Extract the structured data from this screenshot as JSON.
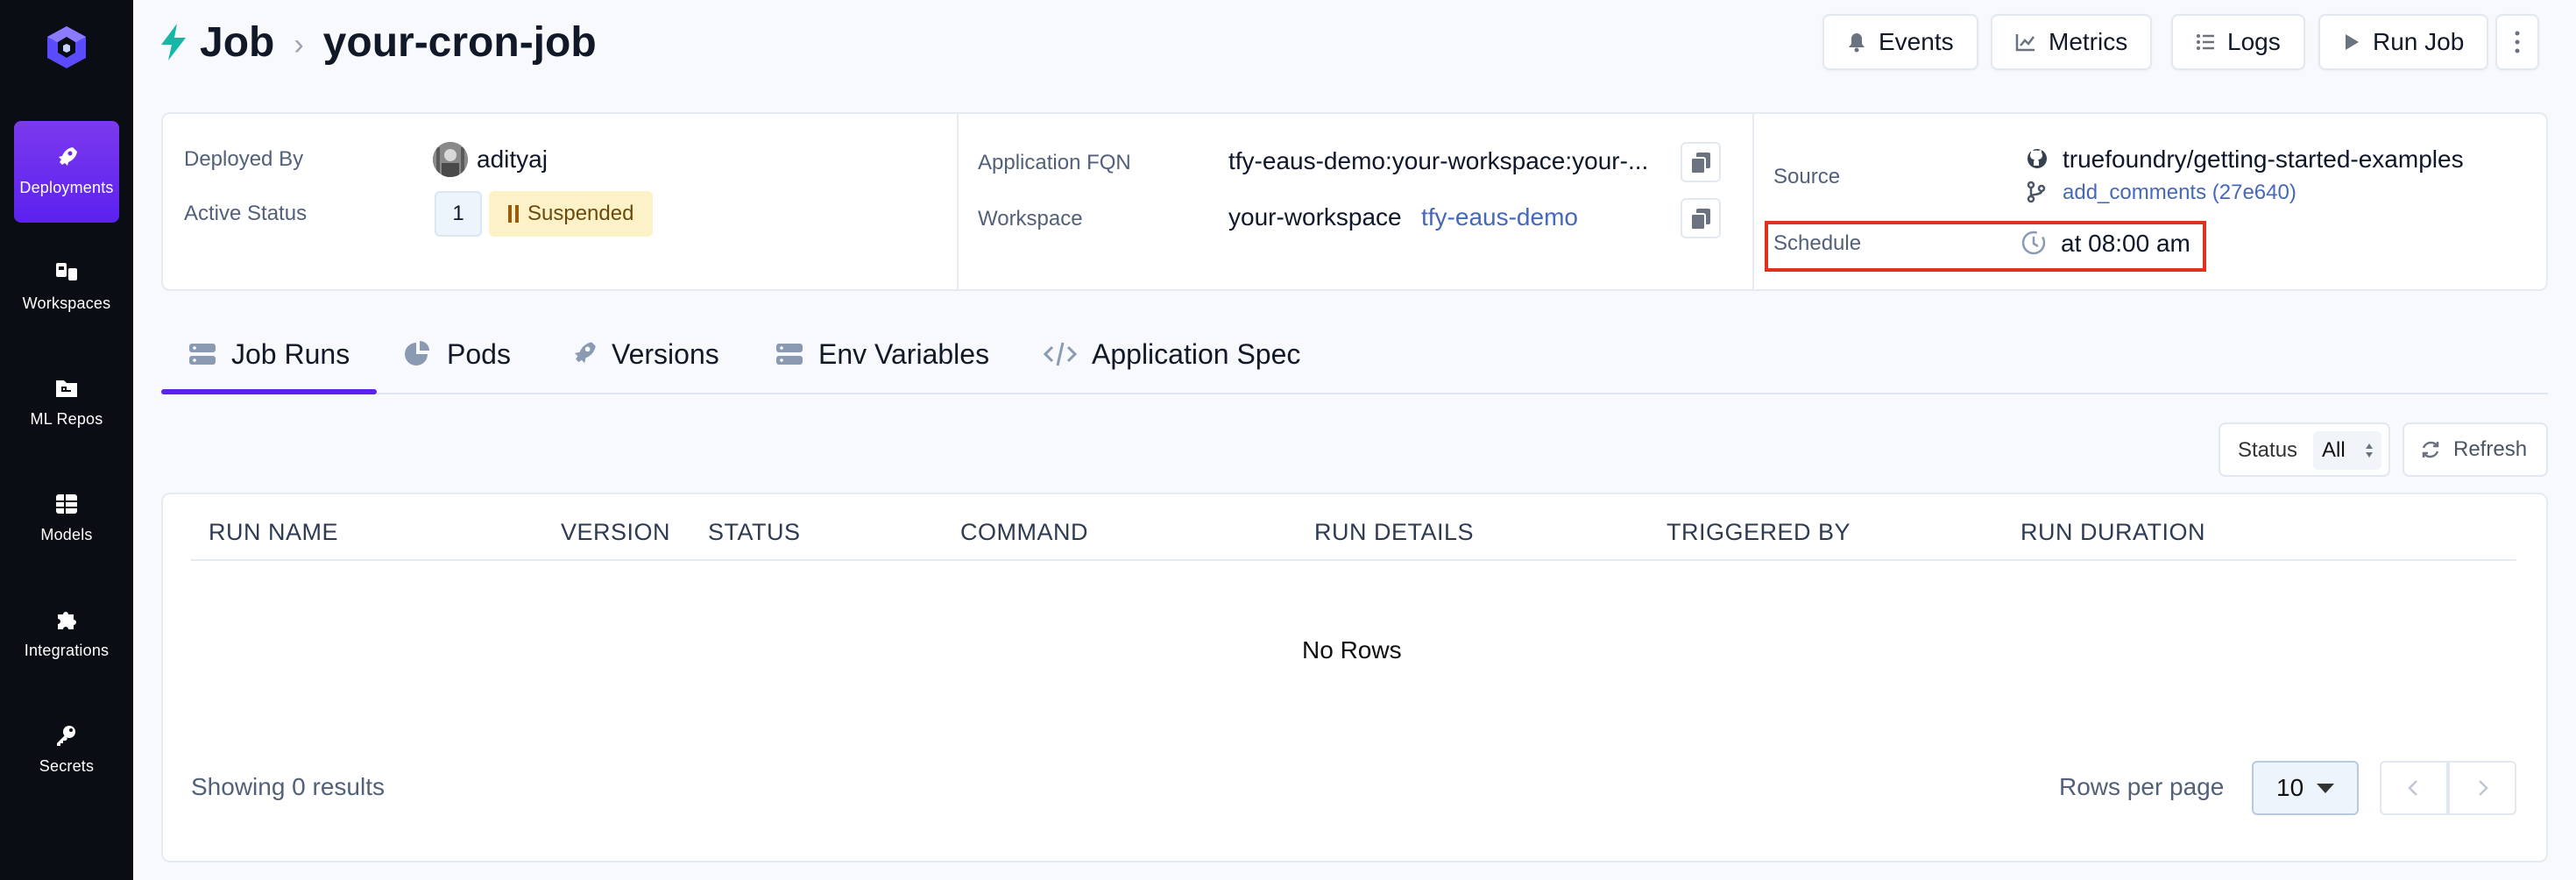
{
  "sidebar": {
    "items": [
      {
        "label": "Deployments",
        "icon": "rocket-icon",
        "active": true
      },
      {
        "label": "Workspaces",
        "icon": "workspaces-icon"
      },
      {
        "label": "ML Repos",
        "icon": "folder-icon"
      },
      {
        "label": "Models",
        "icon": "grid-icon"
      },
      {
        "label": "Integrations",
        "icon": "puzzle-icon"
      },
      {
        "label": "Secrets",
        "icon": "key-icon"
      }
    ]
  },
  "header": {
    "section": "Job",
    "job_name": "your-cron-job",
    "buttons": {
      "events": "Events",
      "metrics": "Metrics",
      "logs": "Logs",
      "run_job": "Run Job"
    }
  },
  "info": {
    "deployed_by_label": "Deployed By",
    "deployed_by": "adityaj",
    "active_status_label": "Active Status",
    "active_count": "1",
    "status": "Suspended",
    "fqn_label": "Application FQN",
    "fqn": "tfy-eaus-demo:your-workspace:your-...",
    "workspace_label": "Workspace",
    "workspace": "your-workspace",
    "cluster": "tfy-eaus-demo",
    "source_label": "Source",
    "repo": "truefoundry/getting-started-examples",
    "branch": "add_comments (27e640)",
    "schedule_label": "Schedule",
    "schedule": "at 08:00 am"
  },
  "tabs": [
    {
      "label": "Job Runs",
      "active": true
    },
    {
      "label": "Pods"
    },
    {
      "label": "Versions"
    },
    {
      "label": "Env Variables"
    },
    {
      "label": "Application Spec"
    }
  ],
  "toolbar": {
    "status_label": "Status",
    "status_value": "All",
    "refresh": "Refresh"
  },
  "table": {
    "columns": [
      "RUN NAME",
      "VERSION",
      "STATUS",
      "COMMAND",
      "RUN DETAILS",
      "TRIGGERED BY",
      "RUN DURATION"
    ],
    "empty": "No Rows",
    "showing": "Showing 0 results",
    "rows_per_page_label": "Rows per page",
    "rows_per_page": "10"
  },
  "colors": {
    "accent": "#5b21f0",
    "sidebar_bg": "#0b0d14",
    "suspended_bg": "#fdf1c7",
    "highlight": "#e0301e",
    "bolt": "#14b8a6"
  }
}
